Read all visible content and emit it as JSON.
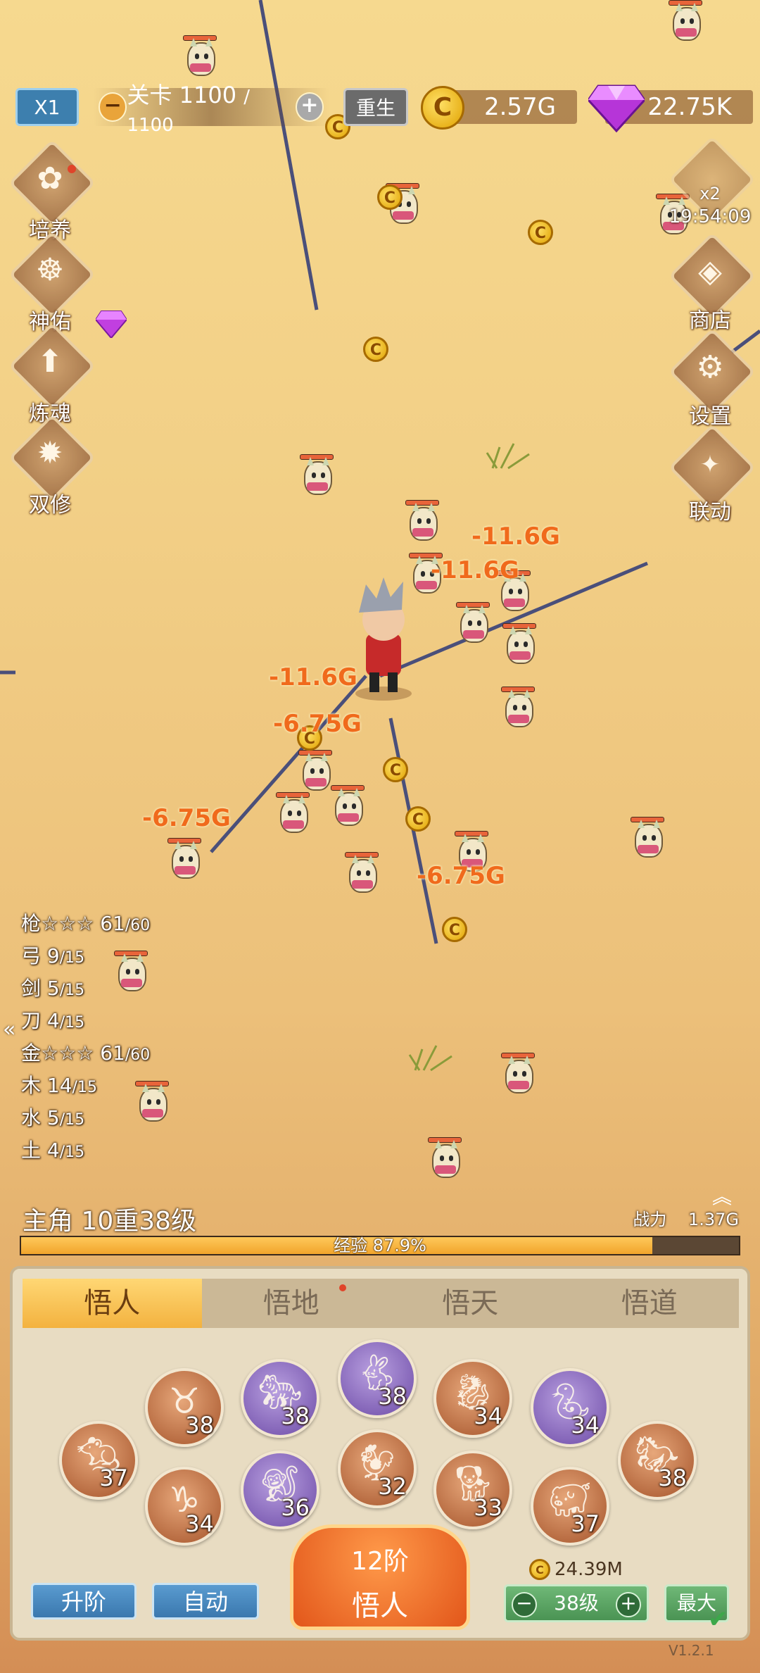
{
  "top_bar": {
    "speed_label": "X1",
    "stage_minus": "−",
    "stage_label": "关卡 1100",
    "stage_max": "/ 1100",
    "stage_plus": "+",
    "rebirth_label": "重生",
    "gold_value": "2.57G",
    "gem_value": "22.75K"
  },
  "left_menu": [
    {
      "label": "培养",
      "icon": "cultivate-icon"
    },
    {
      "label": "神佑",
      "icon": "blessing-icon"
    },
    {
      "label": "炼魂",
      "icon": "soul-refine-icon"
    },
    {
      "label": "双修",
      "icon": "dual-cultivation-icon"
    }
  ],
  "right_menu": {
    "bonus_multiplier": "x2",
    "bonus_timer": "19:54:09",
    "shop_label": "商店",
    "settings_label": "设置",
    "collab_label": "联动"
  },
  "damage_numbers": [
    "-11.6G",
    "-11.6G",
    "-11.6G",
    "-6.75G",
    "-6.75G",
    "-6.75G"
  ],
  "weapon_stats": [
    {
      "name": "枪☆☆☆ 61",
      "max": "/60"
    },
    {
      "name": "弓 9",
      "max": "/15"
    },
    {
      "name": "剑 5",
      "max": "/15"
    },
    {
      "name": "刀 4",
      "max": "/15"
    },
    {
      "name": "金☆☆☆ 61",
      "max": "/60"
    },
    {
      "name": "木 14",
      "max": "/15"
    },
    {
      "name": "水 5",
      "max": "/15"
    },
    {
      "name": "土 4",
      "max": "/15"
    }
  ],
  "hero": {
    "title": "主角 10重38级",
    "power_label": "战力",
    "power_value": "1.37G",
    "exp_text": "经验 87.9%",
    "exp_fraction": 0.879
  },
  "panel": {
    "tabs": [
      "悟人",
      "悟地",
      "悟天",
      "悟道"
    ],
    "active_tab": 0,
    "zodiac": [
      {
        "name": "rat",
        "level": "37"
      },
      {
        "name": "ox",
        "level": "38"
      },
      {
        "name": "tiger",
        "level": "38"
      },
      {
        "name": "rabbit",
        "level": "38"
      },
      {
        "name": "dragon",
        "level": "34"
      },
      {
        "name": "snake",
        "level": "34"
      },
      {
        "name": "horse",
        "level": "38"
      },
      {
        "name": "goat",
        "level": "34"
      },
      {
        "name": "monkey",
        "level": "36"
      },
      {
        "name": "rooster",
        "level": "32"
      },
      {
        "name": "dog",
        "level": "33"
      },
      {
        "name": "pig",
        "level": "37"
      }
    ],
    "upgrade_label": "升阶",
    "auto_label": "自动",
    "main_button_line1": "12阶",
    "main_button_line2": "悟人",
    "cost_value": "24.39M",
    "level_label": "38级",
    "max_label": "最大",
    "version": "V1.2.1"
  },
  "colors": {
    "accent_orange": "#f06a1c",
    "exp_fill": "#f1a52c",
    "tab_active": "#f3b23f",
    "purple_beast": "#6c4aa6",
    "bronze_beast": "#a4532a"
  }
}
